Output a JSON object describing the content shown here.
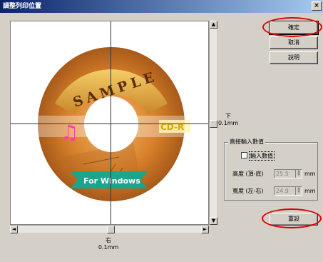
{
  "window": {
    "title": "調整列印位置",
    "close_glyph": "×"
  },
  "preview": {
    "sample_text": "SAMPLE",
    "badge_text": "CD-R",
    "banner_text": "For Windows"
  },
  "scroll": {
    "up": "▲",
    "down": "▼",
    "left": "◄",
    "right": "►"
  },
  "vertical_offset": {
    "direction": "下",
    "value": "0.1mm"
  },
  "horizontal_offset": {
    "direction": "右",
    "value": "0.1mm"
  },
  "buttons": {
    "ok": "確定",
    "cancel": "取消",
    "help": "說明",
    "reset": "重設"
  },
  "direct_input": {
    "group_title": "直接輸入數值",
    "checkbox_label": "輸入數值",
    "checked": false,
    "height_label": "高度 (頂-底)",
    "height_value": "25.5",
    "width_label": "寬度 (左-右)",
    "width_value": "24.9",
    "unit": "mm"
  },
  "colors": {
    "highlight_ring": "#e00000",
    "disc_orange": "#d9822b",
    "banner_teal": "#1aa58c",
    "sample_band": "#e8b64a"
  }
}
